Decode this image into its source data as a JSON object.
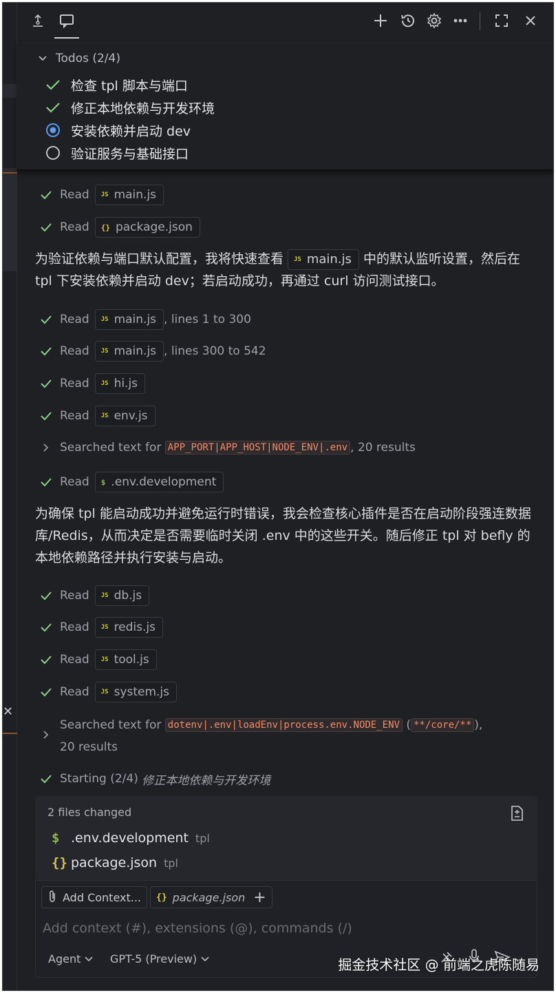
{
  "header": {
    "icons": [
      "pin-icon",
      "chat-icon",
      "plus-icon",
      "history-icon",
      "gear-icon",
      "more-icon",
      "maximize-icon",
      "close-icon"
    ]
  },
  "todos": {
    "title": "Todos (2/4)",
    "items": [
      {
        "label": "检查 tpl 脚本与端口",
        "status": "done"
      },
      {
        "label": "修正本地依赖与开发环境",
        "status": "done"
      },
      {
        "label": "安装依赖并启动 dev",
        "status": "in-progress"
      },
      {
        "label": "验证服务与基础接口",
        "status": "pending"
      }
    ]
  },
  "chat": {
    "read_label": "Read",
    "r1": {
      "file": "main.js"
    },
    "r2": {
      "file": "package.json"
    },
    "p1": {
      "a": "为验证依赖与端口默认配置，我将快速查看",
      "chip": "main.js",
      "b": "中的默认监听设置，然后在 tpl 下安装依赖并启动 dev；若启动成功，再通过 curl 访问测试接口。"
    },
    "r3": {
      "file": "main.js",
      "suffix": ", lines 1 to 300"
    },
    "r4": {
      "file": "main.js",
      "suffix": ", lines 300 to 542"
    },
    "r5": {
      "file": "hi.js"
    },
    "r6": {
      "file": "env.js"
    },
    "s1": {
      "label": "Searched text for",
      "code": "APP_PORT|APP_HOST|NODE_ENV|.env",
      "suffix": ", 20 results"
    },
    "r7": {
      "file": ".env.development"
    },
    "p2": {
      "text": "为确保 tpl 能启动成功并避免运行时错误，我会检查核心插件是否在启动阶段强连数据库/Redis，从而决定是否需要临时关闭 .env 中的这些开关。随后修正 tpl 对 befly 的本地依赖路径并执行安装与启动。"
    },
    "r8": {
      "file": "db.js"
    },
    "r9": {
      "file": "redis.js"
    },
    "r10": {
      "file": "tool.js"
    },
    "r11": {
      "file": "system.js"
    },
    "s2": {
      "label": "Searched text for",
      "code": "dotenv|.env|loadEnv|process.env.NODE_ENV",
      "open": "(",
      "code2": "**/core/**",
      "close": "),",
      "line2": "20 results"
    },
    "starting": {
      "label": "Starting (2/4)",
      "task": "修正本地依赖与开发环境"
    }
  },
  "files_changed": {
    "title": "2 files changed",
    "files": [
      {
        "icon": "$",
        "name": ".env.development",
        "dir": "tpl",
        "color": "#8db357"
      },
      {
        "icon": "{}",
        "name": "package.json",
        "dir": "tpl",
        "color": "#d8c35a"
      }
    ]
  },
  "input": {
    "add_context": "Add Context...",
    "attached": "package.json",
    "placeholder": "Add context (#), extensions (@), commands (/)",
    "mode": "Agent",
    "model": "GPT-5 (Preview)"
  },
  "watermark": "掘金技术社区 @ 前端之虎陈随易",
  "colors": {
    "background": "#1f2024",
    "check": "#89d185",
    "progress": "#5b9bf0",
    "code": "#f28b6c"
  }
}
